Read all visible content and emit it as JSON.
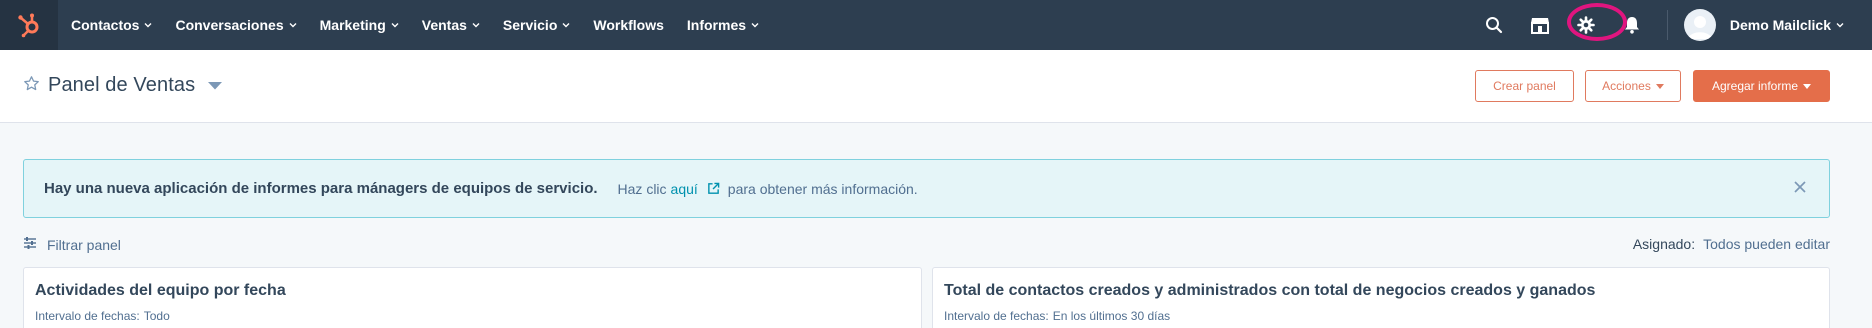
{
  "nav": {
    "items": [
      {
        "label": "Contactos",
        "has_dropdown": true
      },
      {
        "label": "Conversaciones",
        "has_dropdown": true
      },
      {
        "label": "Marketing",
        "has_dropdown": true
      },
      {
        "label": "Ventas",
        "has_dropdown": true
      },
      {
        "label": "Servicio",
        "has_dropdown": true
      },
      {
        "label": "Workflows",
        "has_dropdown": false
      },
      {
        "label": "Informes",
        "has_dropdown": true
      }
    ],
    "account_name": "Demo Mailclick",
    "icons": [
      "search-icon",
      "marketplace-icon",
      "settings-icon",
      "notifications-icon"
    ]
  },
  "header": {
    "title": "Panel de Ventas",
    "buttons": {
      "create": "Crear panel",
      "actions": "Acciones",
      "add_report": "Agregar informe"
    }
  },
  "alert": {
    "strong": "Hay una nueva aplicación de informes para mánagers de equipos de servicio.",
    "text_before": "Haz clic",
    "link": "aquí",
    "text_after": "para obtener más información."
  },
  "filter": {
    "label": "Filtrar panel",
    "assigned_label": "Asignado:",
    "assigned_value": "Todos pueden editar"
  },
  "reports": [
    {
      "title": "Actividades del equipo por fecha",
      "date_label": "Intervalo de fechas:",
      "date_value": "Todo"
    },
    {
      "title": "Total de contactos creados y administrados con total de negocios creados y ganados",
      "date_label": "Intervalo de fechas:",
      "date_value": "En los últimos 30 días"
    }
  ],
  "colors": {
    "nav_bg": "#2d3e50",
    "brand_orange": "#ff7a59",
    "primary_button": "#e46e4a",
    "alert_bg": "#e5f5f8",
    "highlight_ring": "#e0157f"
  }
}
